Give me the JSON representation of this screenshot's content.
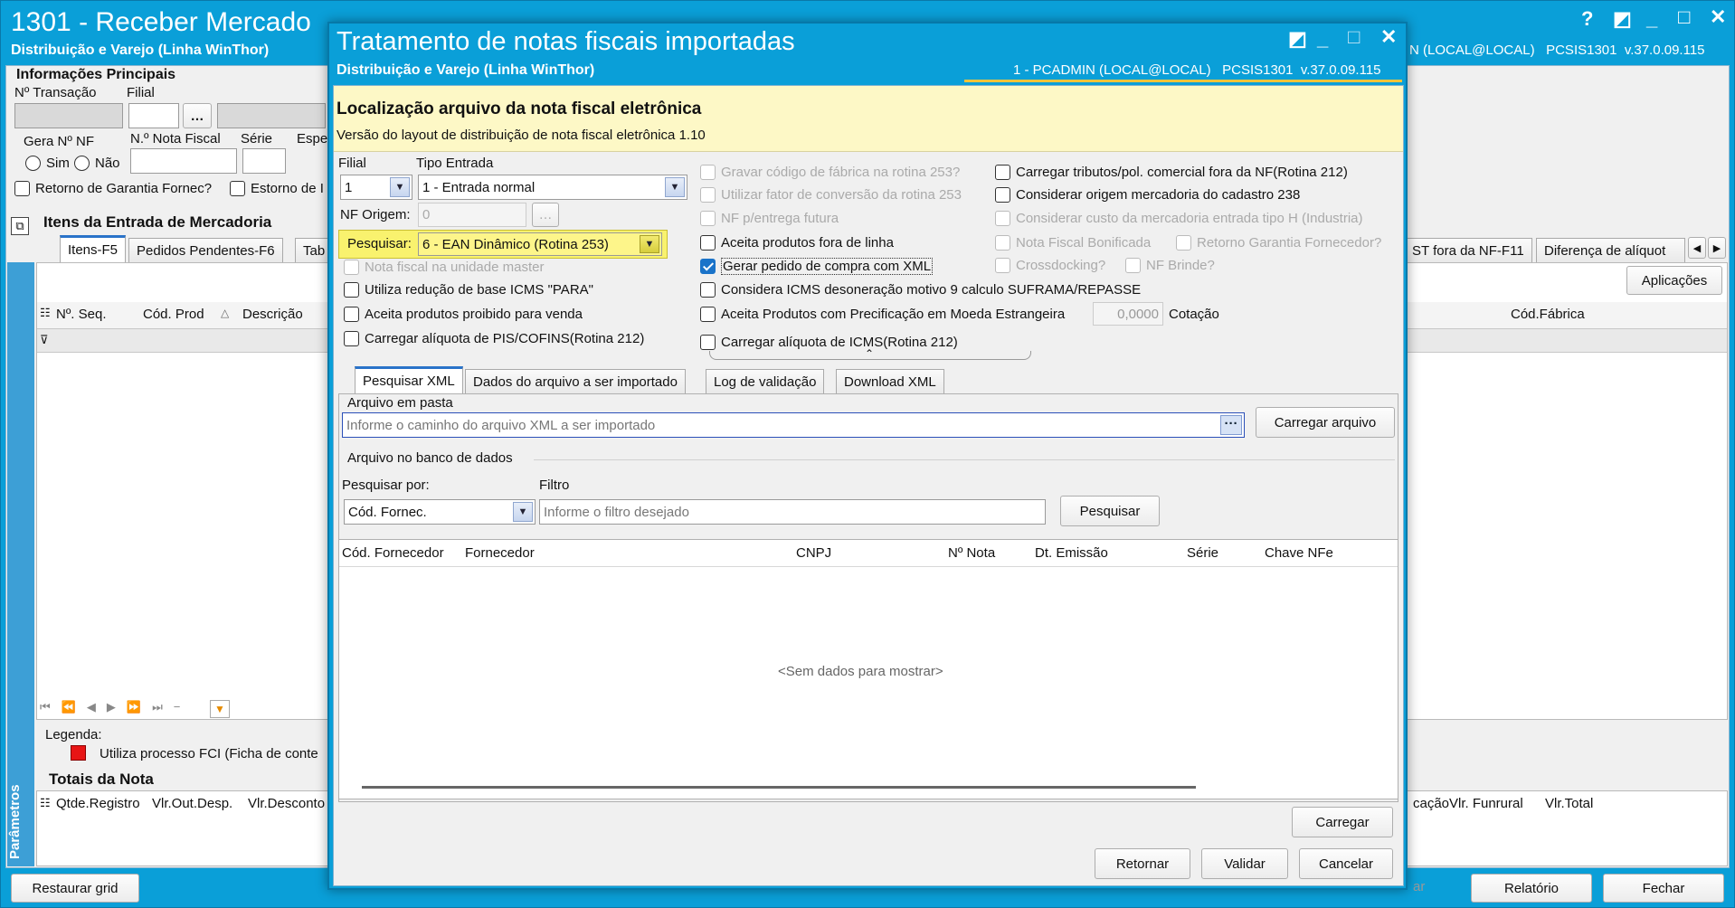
{
  "main": {
    "title": "1301 - Receber Mercado",
    "subtitle": "Distribuição e Varejo (Linha WinThor)",
    "user_info": "N (LOCAL@LOCAL)   PCSIS1301  v.37.0.09.115",
    "section_info": "Informações Principais",
    "lbl_transacao": "Nº Transação",
    "lbl_filial": "Filial",
    "lbl_gera_nf": "Gera Nº NF",
    "lbl_nota_fiscal": "N.º Nota Fiscal",
    "lbl_serie": "Série",
    "lbl_espe": "Espe",
    "radio_sim": "Sim",
    "radio_nao": "Não",
    "chk_retorno": "Retorno de Garantia Fornec?",
    "chk_estorno": "Estorno de I",
    "items_title": "Itens da Entrada de Mercadoria",
    "tabs": [
      "Itens-F5",
      "Pedidos Pendentes-F6",
      "Tab"
    ],
    "right_tabs": [
      "ST fora da NF-F11",
      "Diferença de alíquot"
    ],
    "aplicacoes": "Aplicações",
    "grid_cols": [
      "Nº. Seq.",
      "Cód. Prod",
      "Descrição"
    ],
    "grid_col_right": "Cód.Fábrica",
    "legenda": "Legenda:",
    "legenda_item": "Utiliza processo FCI (Ficha de conte",
    "totais": "Totais da Nota",
    "totais_cols": [
      "Qtde.Registro",
      "Vlr.Out.Desp.",
      "Vlr.Desconto"
    ],
    "totais_right_cols": [
      "cação",
      "Vlr. Funrural",
      "Vlr.Total"
    ],
    "parametros": "Parâmetros",
    "btn_restaurar": "Restaurar grid",
    "btn_relatorio": "Relatório",
    "btn_fechar": "Fechar",
    "btn_partial": "ar"
  },
  "dialog": {
    "title": "Tratamento de notas fiscais importadas",
    "subtitle": "Distribuição e Varejo (Linha WinThor)",
    "user_info": "1 - PCADMIN (LOCAL@LOCAL)   PCSIS1301  v.37.0.09.115",
    "header_title": "Localização arquivo da nota fiscal eletrônica",
    "header_sub": "Versão do layout de distribuição de nota fiscal eletrônica 1.10",
    "lbl_filial": "Filial",
    "filial_value": "1",
    "lbl_tipo_entrada": "Tipo Entrada",
    "tipo_entrada_value": "1 - Entrada normal",
    "lbl_nf_origem": "NF Origem:",
    "nf_origem_value": "0",
    "lbl_pesquisar": "Pesquisar:",
    "pesquisar_value": "6 - EAN Dinâmico (Rotina 253)",
    "left_checks": [
      {
        "label": "Nota fiscal na unidade master",
        "state": "disabled"
      },
      {
        "label": "Utiliza redução de base ICMS \"PARA\"",
        "state": "normal"
      },
      {
        "label": "Aceita produtos proibido para venda",
        "state": "normal"
      },
      {
        "label": "Carregar alíquota de PIS/COFINS(Rotina 212)",
        "state": "normal"
      }
    ],
    "mid_checks": [
      {
        "label": "Gravar código de fábrica na rotina 253?",
        "state": "disabled"
      },
      {
        "label": "Utilizar fator de conversão da rotina 253",
        "state": "disabled"
      },
      {
        "label": "NF p/entrega futura",
        "state": "disabled"
      },
      {
        "label": "Aceita produtos fora de linha",
        "state": "normal"
      },
      {
        "label": "Gerar pedido de compra com XML",
        "state": "checked"
      },
      {
        "label": "Considera ICMS desoneração motivo 9 calculo SUFRAMA/REPASSE",
        "state": "normal"
      },
      {
        "label": "Aceita Produtos com Precificação em Moeda Estrangeira",
        "state": "normal"
      },
      {
        "label": "Carregar alíquota de ICMS(Rotina 212)",
        "state": "normal"
      }
    ],
    "cotacao_value": "0,0000",
    "lbl_cotacao": "Cotação",
    "right_checks": [
      {
        "label": "Carregar tributos/pol. comercial fora da NF(Rotina 212)",
        "state": "normal"
      },
      {
        "label": "Considerar origem mercadoria do cadastro 238",
        "state": "normal"
      },
      {
        "label": "Considerar custo da mercadoria entrada tipo H (Industria)",
        "state": "disabled"
      },
      {
        "label": "Nota Fiscal Bonificada",
        "state": "disabled"
      },
      {
        "label": "Retorno Garantia Fornecedor?",
        "state": "disabled"
      },
      {
        "label": "Crossdocking?",
        "state": "disabled"
      },
      {
        "label": "NF Brinde?",
        "state": "disabled"
      }
    ],
    "tabs": [
      "Pesquisar XML",
      "Dados do arquivo a ser importado",
      "Log de validação",
      "Download XML"
    ],
    "lbl_arquivo_pasta": "Arquivo em pasta",
    "arquivo_placeholder": "Informe o caminho do arquivo XML a ser importado",
    "btn_carregar_arquivo": "Carregar arquivo",
    "lbl_arquivo_banco": "Arquivo no banco de dados",
    "lbl_pesquisar_por": "Pesquisar por:",
    "pesquisar_por_value": "Cód. Fornec.",
    "lbl_filtro": "Filtro",
    "filtro_placeholder": "Informe o filtro desejado",
    "btn_pesquisar": "Pesquisar",
    "grid_cols": [
      "Cód. Fornecedor",
      "Fornecedor",
      "CNPJ",
      "Nº Nota",
      "Dt. Emissão",
      "Série",
      "Chave NFe"
    ],
    "grid_empty": "<Sem dados para mostrar>",
    "btn_carregar": "Carregar",
    "btn_retornar": "Retornar",
    "btn_validar": "Validar",
    "btn_cancelar": "Cancelar"
  },
  "colors": {
    "title_bar": "#0a9fd8",
    "dialog_header": "#fdf8c6",
    "highlight": "#f9f26e",
    "check_accent": "#1a73c9"
  }
}
